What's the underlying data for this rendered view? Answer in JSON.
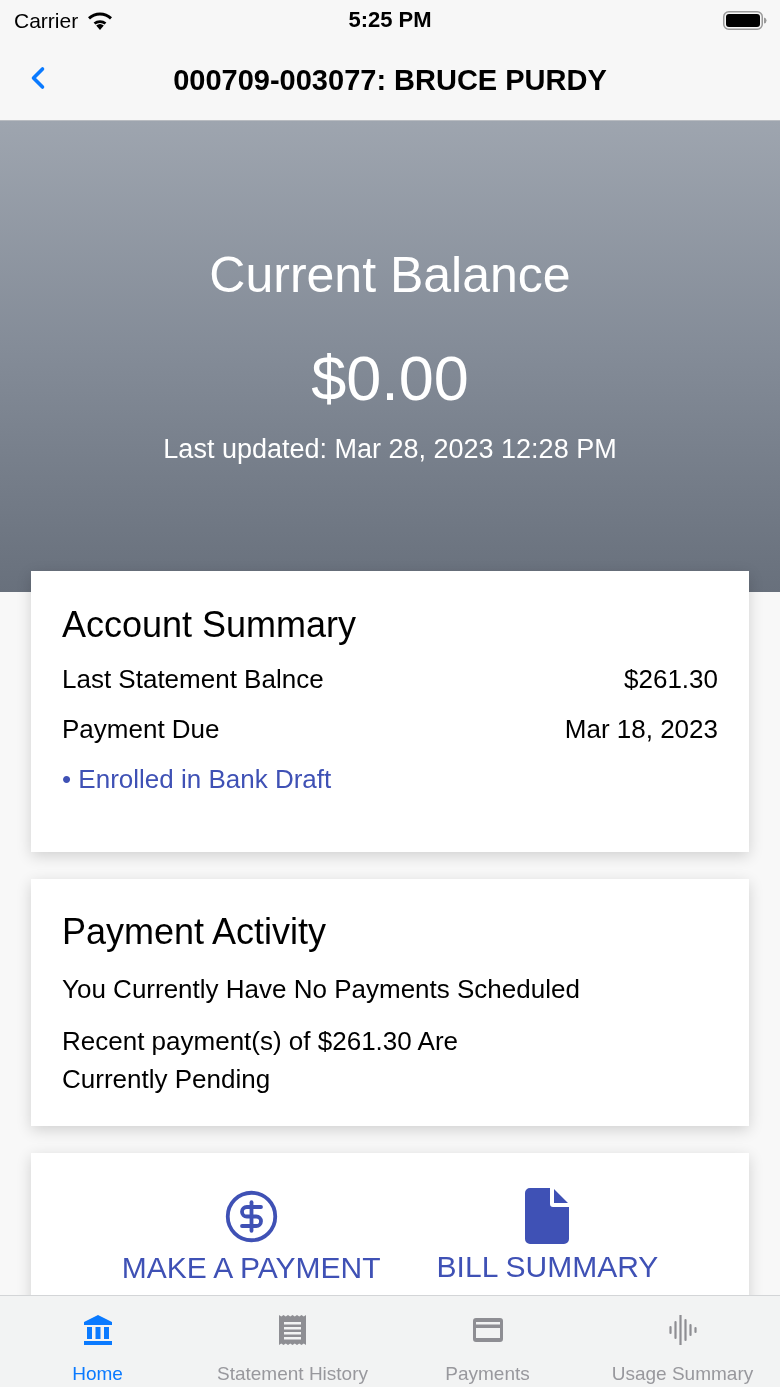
{
  "status_bar": {
    "carrier": "Carrier",
    "time": "5:25 PM"
  },
  "nav_bar": {
    "title": "000709-003077: BRUCE PURDY"
  },
  "balance": {
    "title": "Current Balance",
    "amount": "$0.00",
    "updated": "Last updated: Mar 28, 2023 12:28 PM"
  },
  "account_summary": {
    "title": "Account Summary",
    "rows": [
      {
        "label": "Last Statement Balnce",
        "value": "$261.30"
      },
      {
        "label": "Payment Due",
        "value": "Mar 18, 2023"
      }
    ],
    "note": "• Enrolled in Bank Draft"
  },
  "payment_activity": {
    "title": "Payment Activity",
    "lines": [
      "You Currently Have No Payments Scheduled",
      "Recent payment(s) of $261.30 Are Currently Pending"
    ]
  },
  "actions": [
    {
      "kind": "payment",
      "label": "MAKE A PAYMENT"
    },
    {
      "kind": "document",
      "label": "BILL SUMMARY"
    }
  ],
  "tabs": [
    {
      "kind": "bank",
      "label": "Home",
      "selected": true
    },
    {
      "kind": "receipt",
      "label": "Statement History",
      "selected": false
    },
    {
      "kind": "card",
      "label": "Payments",
      "selected": false
    },
    {
      "kind": "waveform",
      "label": "Usage Summary",
      "selected": false
    }
  ]
}
